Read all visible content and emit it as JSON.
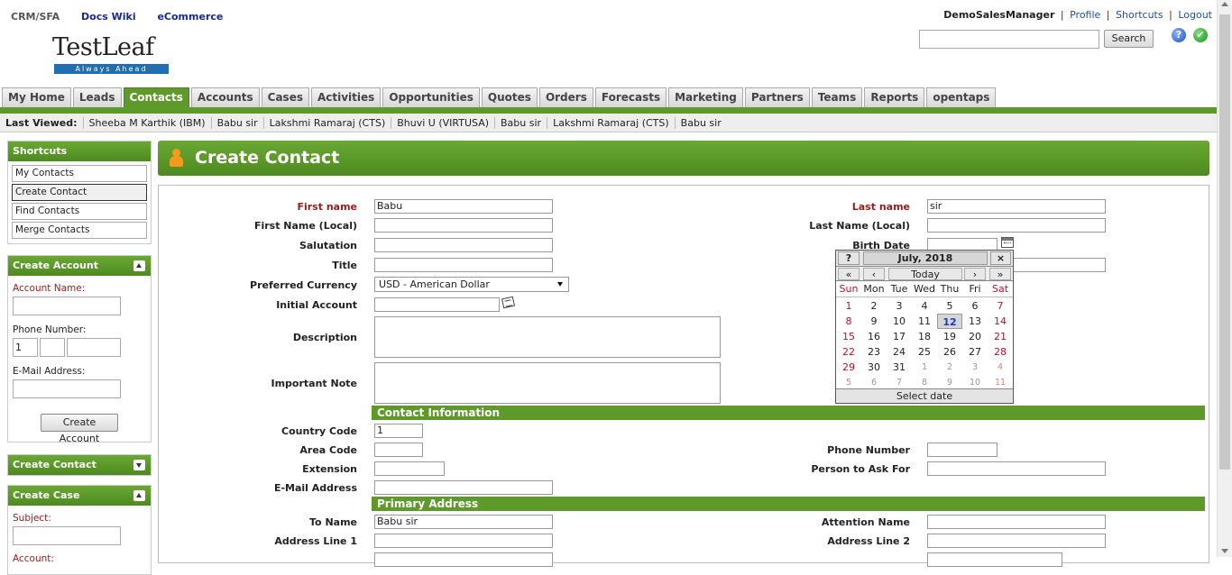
{
  "top_links": {
    "app": "CRM/SFA",
    "docs": "Docs Wiki",
    "ecommerce": "eCommerce"
  },
  "logo": {
    "word": "TestLeaf",
    "tagline": "Always Ahead"
  },
  "user": {
    "name": "DemoSalesManager",
    "profile": "Profile",
    "shortcuts": "Shortcuts",
    "logout": "Logout",
    "sep": "|"
  },
  "search": {
    "button": "Search",
    "value": "",
    "placeholder": ""
  },
  "tabs": [
    "My Home",
    "Leads",
    "Contacts",
    "Accounts",
    "Cases",
    "Activities",
    "Opportunities",
    "Quotes",
    "Orders",
    "Forecasts",
    "Marketing",
    "Partners",
    "Teams",
    "Reports",
    "opentaps"
  ],
  "active_tab": "Contacts",
  "last_viewed": {
    "label": "Last Viewed:",
    "items": [
      "Sheeba M Karthik (IBM)",
      "Babu sir",
      "Lakshmi Ramaraj (CTS)",
      "Bhuvi U (VIRTUSA)",
      "Babu sir",
      "Lakshmi Ramaraj (CTS)",
      "Babu sir"
    ]
  },
  "sidebar": {
    "shortcuts": {
      "title": "Shortcuts",
      "items": [
        "My Contacts",
        "Create Contact",
        "Find Contacts",
        "Merge Contacts"
      ]
    },
    "create_account": {
      "title": "Create Account",
      "account_name": "Account Name:",
      "phone": "Phone Number:",
      "phone_country": "1",
      "email": "E-Mail Address:",
      "button": "Create Account"
    },
    "create_contact": {
      "title": "Create Contact"
    },
    "create_case": {
      "title": "Create Case",
      "subject": "Subject:",
      "account": "Account:"
    }
  },
  "page_title": "Create Contact",
  "form": {
    "first_name": {
      "label": "First name",
      "value": "Babu"
    },
    "last_name": {
      "label": "Last name",
      "value": "sir"
    },
    "first_name_local": {
      "label": "First Name (Local)",
      "value": ""
    },
    "last_name_local": {
      "label": "Last Name (Local)",
      "value": ""
    },
    "salutation": {
      "label": "Salutation",
      "value": ""
    },
    "birth_date": {
      "label": "Birth Date",
      "value": ""
    },
    "title": {
      "label": "Title",
      "value": ""
    },
    "preferred_currency": {
      "label": "Preferred Currency",
      "value": "USD - American Dollar"
    },
    "initial_account": {
      "label": "Initial Account",
      "value": ""
    },
    "description": {
      "label": "Description"
    },
    "important_note": {
      "label": "Important Note"
    },
    "contact_info": {
      "title": "Contact Information",
      "country_code": {
        "label": "Country Code",
        "value": "1"
      },
      "area_code": {
        "label": "Area Code",
        "value": ""
      },
      "phone_number": {
        "label": "Phone Number",
        "value": ""
      },
      "extension": {
        "label": "Extension",
        "value": ""
      },
      "person_to_ask": {
        "label": "Person to Ask For",
        "value": ""
      },
      "email": {
        "label": "E-Mail Address",
        "value": ""
      }
    },
    "primary_address": {
      "title": "Primary Address",
      "to_name": {
        "label": "To Name",
        "value": "Babu sir"
      },
      "attention_name": {
        "label": "Attention Name",
        "value": ""
      },
      "address_line1": {
        "label": "Address Line 1",
        "value": ""
      },
      "address_line2": {
        "label": "Address Line 2",
        "value": ""
      }
    }
  },
  "calendar": {
    "help": "?",
    "close": "×",
    "month_year": "July, 2018",
    "prev_year": "«",
    "prev_month": "‹",
    "today": "Today",
    "next_month": "›",
    "next_year": "»",
    "weekdays": [
      "Sun",
      "Mon",
      "Tue",
      "Wed",
      "Thu",
      "Fri",
      "Sat"
    ],
    "weeks": [
      [
        "1",
        "2",
        "3",
        "4",
        "5",
        "6",
        "7"
      ],
      [
        "8",
        "9",
        "10",
        "11",
        "12",
        "13",
        "14"
      ],
      [
        "15",
        "16",
        "17",
        "18",
        "19",
        "20",
        "21"
      ],
      [
        "22",
        "23",
        "24",
        "25",
        "26",
        "27",
        "28"
      ],
      [
        "29",
        "30",
        "31",
        "1",
        "2",
        "3",
        "4"
      ],
      [
        "5",
        "6",
        "7",
        "8",
        "9",
        "10",
        "11"
      ]
    ],
    "selected": "12",
    "footer": "Select date"
  },
  "colors": {
    "accent": "#5e9a2a",
    "required": "#9a1b1b",
    "weekend": "#c0102a"
  }
}
